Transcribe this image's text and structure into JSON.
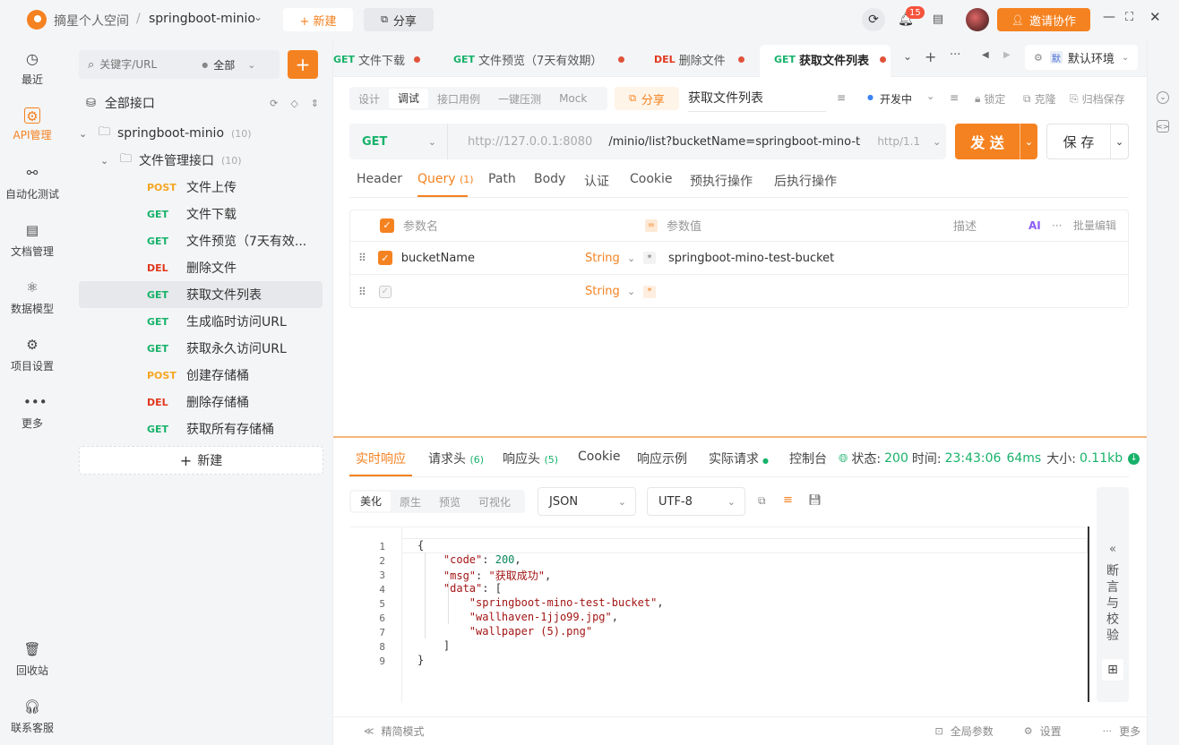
{
  "topbar": {
    "workspace": "摘星个人空间",
    "separator": "/",
    "project": "springboot-minio",
    "new_button": "+ 新建",
    "share_button": "分享",
    "notif_count": "15",
    "invite_button": "邀请协作",
    "accent": "#f58220"
  },
  "nav": {
    "items": [
      {
        "label": "最近",
        "icon": "clock-icon"
      },
      {
        "label": "API管理",
        "icon": "api-icon"
      },
      {
        "label": "自动化测试",
        "icon": "flow-icon"
      },
      {
        "label": "文档管理",
        "icon": "doc-icon"
      },
      {
        "label": "数据模型",
        "icon": "model-icon"
      },
      {
        "label": "项目设置",
        "icon": "settings-icon"
      },
      {
        "label": "更多",
        "icon": "more-icon"
      }
    ],
    "recycle": "回收站",
    "support": "联系客服"
  },
  "tree": {
    "search_placeholder": "关键字/URL",
    "filter": "全部",
    "root_label": "全部接口",
    "project": {
      "name": "springboot-minio",
      "count": "(10)"
    },
    "folder": {
      "name": "文件管理接口",
      "count": "(10)"
    },
    "apis": [
      {
        "method": "POST",
        "name": "文件上传"
      },
      {
        "method": "GET",
        "name": "文件下载"
      },
      {
        "method": "GET",
        "name": "文件预览（7天有效..."
      },
      {
        "method": "DEL",
        "name": "删除文件"
      },
      {
        "method": "GET",
        "name": "获取文件列表"
      },
      {
        "method": "GET",
        "name": "生成临时访问URL"
      },
      {
        "method": "GET",
        "name": "获取永久访问URL"
      },
      {
        "method": "POST",
        "name": "创建存储桶"
      },
      {
        "method": "DEL",
        "name": "删除存储桶"
      },
      {
        "method": "GET",
        "name": "获取所有存储桶"
      }
    ],
    "new_label": "新建"
  },
  "tabs": [
    {
      "method": "GET",
      "name": "文件下载"
    },
    {
      "method": "GET",
      "name": "文件预览（7天有效期）"
    },
    {
      "method": "DEL",
      "name": "删除文件"
    },
    {
      "method": "GET",
      "name": "获取文件列表"
    }
  ],
  "env": {
    "badge": "默",
    "label": "默认环境"
  },
  "subtabs": [
    "设计",
    "调试",
    "接口用例",
    "一键压测",
    "Mock"
  ],
  "request": {
    "share": "分享",
    "name": "获取文件列表",
    "status": "开发中",
    "lock": "锁定",
    "clone": "克隆",
    "archive": "归档保存",
    "method": "GET",
    "base_url": "http://127.0.0.1:8080",
    "path": "/minio/list?bucketName=springboot-mino-te",
    "protocol": "http/1.1",
    "send": "发 送",
    "save": "保 存"
  },
  "query_tabs": [
    "Header",
    "Query",
    "Path",
    "Body",
    "认证",
    "Cookie",
    "预执行操作",
    "后执行操作"
  ],
  "query_count": "(1)",
  "params": {
    "head_name": "参数名",
    "head_value": "参数值",
    "head_desc": "描述",
    "ai": "AI",
    "bulk_edit": "批量编辑",
    "rows": [
      {
        "name": "bucketName",
        "type": "String",
        "value": "springboot-mino-test-bucket"
      },
      {
        "name": "",
        "type": "String",
        "value": ""
      }
    ]
  },
  "response": {
    "tabs": [
      "实时响应",
      "请求头",
      "响应头",
      "Cookie",
      "响应示例",
      "实际请求",
      "控制台"
    ],
    "req_headers_count": "(6)",
    "resp_headers_count": "(5)",
    "status_label": "状态:",
    "status_value": "200",
    "time_label": "时间:",
    "time_value": "23:43:06",
    "duration": "64ms",
    "size_label": "大小:",
    "size_value": "0.11kb",
    "view_modes": [
      "美化",
      "原生",
      "预览",
      "可视化"
    ],
    "format": "JSON",
    "encoding": "UTF-8",
    "assert_panel": "断言与校验"
  },
  "code": [
    {
      "n": "1",
      "t": "{"
    },
    {
      "n": "2",
      "t": "    \"code\": 200,"
    },
    {
      "n": "3",
      "t": "    \"msg\": \"获取成功\","
    },
    {
      "n": "4",
      "t": "    \"data\": ["
    },
    {
      "n": "5",
      "t": "        \"springboot-mino-test-bucket\","
    },
    {
      "n": "6",
      "t": "        \"wallhaven-1jjo99.jpg\","
    },
    {
      "n": "7",
      "t": "        \"wallpaper (5).png\""
    },
    {
      "n": "8",
      "t": "    ]"
    },
    {
      "n": "9",
      "t": "}"
    }
  ],
  "bottombar": {
    "simple_mode": "精简模式",
    "global_params": "全局参数",
    "settings": "设置",
    "more": "更多"
  }
}
